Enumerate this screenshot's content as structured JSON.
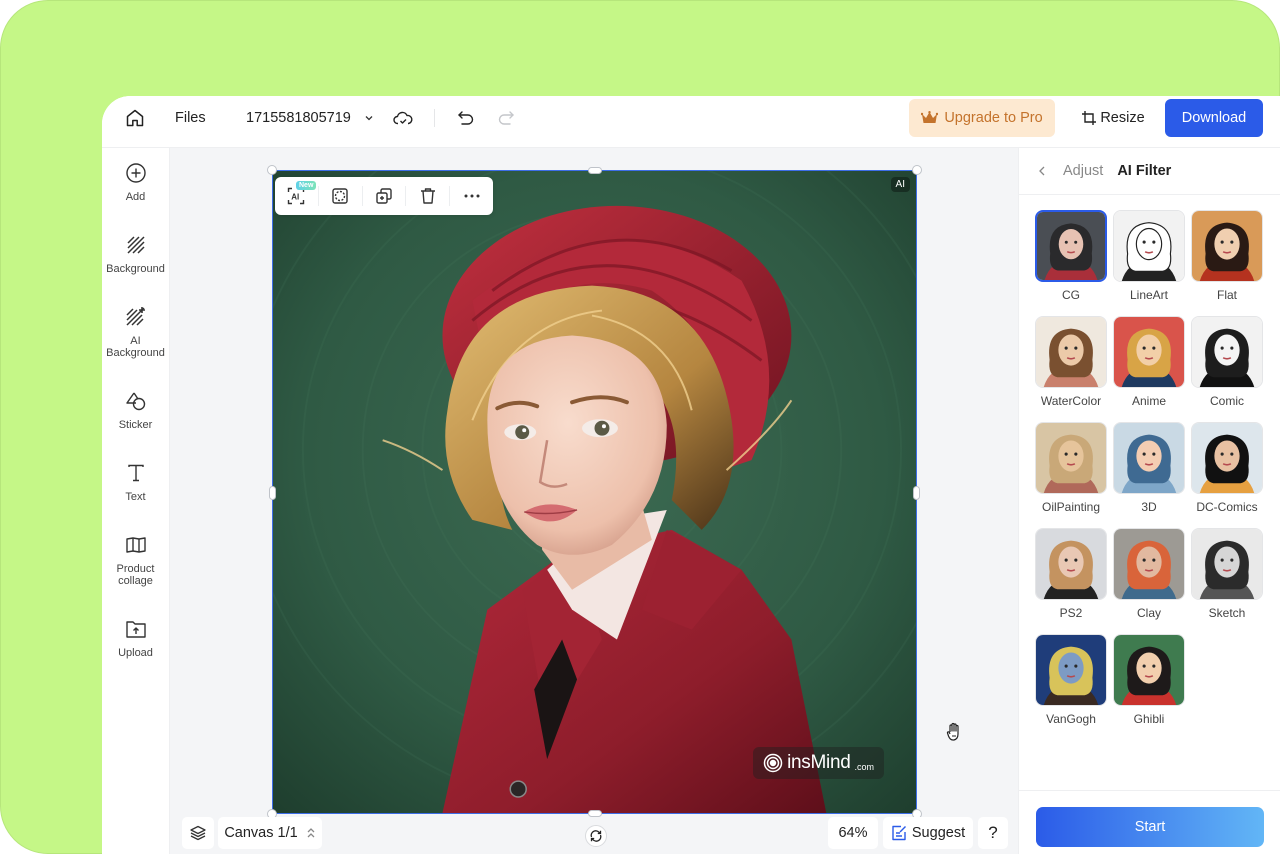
{
  "topbar": {
    "files_label": "Files",
    "file_name": "1715581805719",
    "upgrade_label": "Upgrade to Pro",
    "resize_label": "Resize",
    "download_label": "Download"
  },
  "sidebar": {
    "items": [
      {
        "label": "Add",
        "icon": "plus-circle-icon"
      },
      {
        "label": "Background",
        "icon": "hatch-icon"
      },
      {
        "label": "AI Background",
        "icon": "ai-hatch-icon"
      },
      {
        "label": "Sticker",
        "icon": "sticker-icon"
      },
      {
        "label": "Text",
        "icon": "text-icon"
      },
      {
        "label": "Product collage",
        "icon": "collage-icon"
      },
      {
        "label": "Upload",
        "icon": "upload-folder-icon"
      }
    ]
  },
  "canvas": {
    "toolbar_new_badge": "New",
    "toolbar_ai_label": "AI",
    "ai_tag": "AI",
    "watermark_brand": "insMind",
    "watermark_suffix": ".com",
    "canvas_label": "Canvas 1/1",
    "zoom_level": "64%",
    "suggest_label": "Suggest",
    "help_label": "?"
  },
  "right_panel": {
    "back_label": "Adjust",
    "title": "AI Filter",
    "selected_filter": "CG",
    "filters": [
      {
        "label": "CG",
        "bg": "#4a4e54",
        "skin": "#e7c2b3",
        "hair": "#2a2a2c",
        "accent": "#a92f3a"
      },
      {
        "label": "LineArt",
        "bg": "#f2f2f2",
        "skin": "#ffffff",
        "hair": "#ffffff",
        "accent": "#222222"
      },
      {
        "label": "Flat",
        "bg": "#d99a58",
        "skin": "#f0cfb0",
        "hair": "#2a1a14",
        "accent": "#b5321f"
      },
      {
        "label": "WaterColor",
        "bg": "#efe8de",
        "skin": "#eccaa9",
        "hair": "#7a5030",
        "accent": "#c9806c"
      },
      {
        "label": "Anime",
        "bg": "#d9544b",
        "skin": "#f2cfa8",
        "hair": "#d8a446",
        "accent": "#1f3a60"
      },
      {
        "label": "Comic",
        "bg": "#f2f2f2",
        "skin": "#f4f4f4",
        "hair": "#1d1d1d",
        "accent": "#111111"
      },
      {
        "label": "OilPainting",
        "bg": "#d8c5a4",
        "skin": "#e6c49b",
        "hair": "#c9a878",
        "accent": "#b0695a"
      },
      {
        "label": "3D",
        "bg": "#c9d9e4",
        "skin": "#f4cdb2",
        "hair": "#3f6a92",
        "accent": "#7ea6c8"
      },
      {
        "label": "DC-Comics",
        "bg": "#dde6ec",
        "skin": "#e8c1a2",
        "hair": "#111111",
        "accent": "#e6a040"
      },
      {
        "label": "PS2",
        "bg": "#d8dade",
        "skin": "#e9c8b4",
        "hair": "#c49360",
        "accent": "#222222"
      },
      {
        "label": "Clay",
        "bg": "#9d9a94",
        "skin": "#e2b9a0",
        "hair": "#d9643a",
        "accent": "#3f6a8c"
      },
      {
        "label": "Sketch",
        "bg": "#e9e9e9",
        "skin": "#d6d6d6",
        "hair": "#2b2b2b",
        "accent": "#555555"
      },
      {
        "label": "VanGogh",
        "bg": "#1f3d7a",
        "skin": "#7d9bc4",
        "hair": "#d8c35a",
        "accent": "#3a2a22"
      },
      {
        "label": "Ghibli",
        "bg": "#3f7b4f",
        "skin": "#f2cfae",
        "hair": "#1e1a1a",
        "accent": "#c9322d"
      }
    ],
    "start_label": "Start"
  },
  "colors": {
    "frame_green": "#c5f787",
    "accent_blue": "#2b5be8",
    "upgrade_bg": "#fde9d1",
    "upgrade_text": "#c4732c"
  }
}
